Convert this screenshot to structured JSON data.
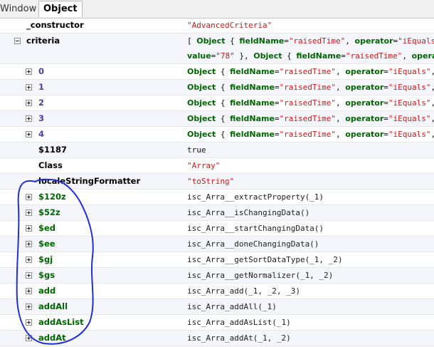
{
  "tabs": {
    "window": "Window",
    "object": "Object"
  },
  "rows": [
    {
      "name": "_constructor",
      "value": "\"AdvancedCriteria\""
    },
    {
      "name": "criteria",
      "line1": [
        {
          "t": "[ ",
          "c": "p"
        },
        {
          "t": "Object",
          "c": "k"
        },
        {
          "t": " { ",
          "c": "p"
        },
        {
          "t": "fieldName",
          "c": "k"
        },
        {
          "t": "=",
          "c": "p"
        },
        {
          "t": "\"raisedTime\"",
          "c": "s"
        },
        {
          "t": ", ",
          "c": "p"
        },
        {
          "t": "operator",
          "c": "k"
        },
        {
          "t": "=",
          "c": "p"
        },
        {
          "t": "\"iEquals\"",
          "c": "s"
        },
        {
          "t": ",",
          "c": "p"
        }
      ],
      "line2": [
        {
          "t": "value",
          "c": "k"
        },
        {
          "t": "=",
          "c": "p"
        },
        {
          "t": "\"78\"",
          "c": "s"
        },
        {
          "t": " }, ",
          "c": "p"
        },
        {
          "t": "Object",
          "c": "k"
        },
        {
          "t": " { ",
          "c": "p"
        },
        {
          "t": "fieldName",
          "c": "k"
        },
        {
          "t": "=",
          "c": "p"
        },
        {
          "t": "\"raisedTime\"",
          "c": "s"
        },
        {
          "t": ", ",
          "c": "p"
        },
        {
          "t": "operato",
          "c": "k"
        }
      ]
    },
    {
      "name": "0",
      "value": [
        {
          "t": "Object",
          "c": "k"
        },
        {
          "t": " { ",
          "c": "p"
        },
        {
          "t": "fieldName",
          "c": "k"
        },
        {
          "t": "=",
          "c": "p"
        },
        {
          "t": "\"raisedTime\"",
          "c": "s"
        },
        {
          "t": ", ",
          "c": "p"
        },
        {
          "t": "operator",
          "c": "k"
        },
        {
          "t": "=",
          "c": "p"
        },
        {
          "t": "\"iEquals\"",
          "c": "s"
        },
        {
          "t": ",",
          "c": "p"
        }
      ]
    },
    {
      "name": "1",
      "value": [
        {
          "t": "Object",
          "c": "k"
        },
        {
          "t": " { ",
          "c": "p"
        },
        {
          "t": "fieldName",
          "c": "k"
        },
        {
          "t": "=",
          "c": "p"
        },
        {
          "t": "\"raisedTime\"",
          "c": "s"
        },
        {
          "t": ", ",
          "c": "p"
        },
        {
          "t": "operator",
          "c": "k"
        },
        {
          "t": "=",
          "c": "p"
        },
        {
          "t": "\"iEquals\"",
          "c": "s"
        },
        {
          "t": ",",
          "c": "p"
        }
      ]
    },
    {
      "name": "2",
      "value": [
        {
          "t": "Object",
          "c": "k"
        },
        {
          "t": " { ",
          "c": "p"
        },
        {
          "t": "fieldName",
          "c": "k"
        },
        {
          "t": "=",
          "c": "p"
        },
        {
          "t": "\"raisedTime\"",
          "c": "s"
        },
        {
          "t": ", ",
          "c": "p"
        },
        {
          "t": "operator",
          "c": "k"
        },
        {
          "t": "=",
          "c": "p"
        },
        {
          "t": "\"iEquals\"",
          "c": "s"
        },
        {
          "t": ",",
          "c": "p"
        }
      ]
    },
    {
      "name": "3",
      "value": [
        {
          "t": "Object",
          "c": "k"
        },
        {
          "t": " { ",
          "c": "p"
        },
        {
          "t": "fieldName",
          "c": "k"
        },
        {
          "t": "=",
          "c": "p"
        },
        {
          "t": "\"raisedTime\"",
          "c": "s"
        },
        {
          "t": ", ",
          "c": "p"
        },
        {
          "t": "operator",
          "c": "k"
        },
        {
          "t": "=",
          "c": "p"
        },
        {
          "t": "\"iEquals\"",
          "c": "s"
        },
        {
          "t": ",",
          "c": "p"
        }
      ]
    },
    {
      "name": "4",
      "value": [
        {
          "t": "Object",
          "c": "k"
        },
        {
          "t": " { ",
          "c": "p"
        },
        {
          "t": "fieldName",
          "c": "k"
        },
        {
          "t": "=",
          "c": "p"
        },
        {
          "t": "\"raisedTime\"",
          "c": "s"
        },
        {
          "t": ", ",
          "c": "p"
        },
        {
          "t": "operator",
          "c": "k"
        },
        {
          "t": "=",
          "c": "p"
        },
        {
          "t": "\"iEquals\"",
          "c": "s"
        },
        {
          "t": ",",
          "c": "p"
        }
      ]
    },
    {
      "name": "$1187",
      "value": "true"
    },
    {
      "name": "Class",
      "value": "\"Array\""
    },
    {
      "name": "localeStringFormatter",
      "value": "\"toString\""
    },
    {
      "name": "$120z",
      "value": "isc_Arra__extractProperty(_1)"
    },
    {
      "name": "$52z",
      "value": "isc_Arra__isChangingData()"
    },
    {
      "name": "$ed",
      "value": "isc_Arra__startChangingData()"
    },
    {
      "name": "$ee",
      "value": "isc_Arra__doneChangingData()"
    },
    {
      "name": "$gj",
      "value": "isc_Arra__getSortDataType(_1, _2)"
    },
    {
      "name": "$gs",
      "value": "isc_Arra__getNormalizer(_1, _2)"
    },
    {
      "name": "add",
      "value": "isc_Arra_add(_1, _2, _3)"
    },
    {
      "name": "addAll",
      "value": "isc_Arra_addAll(_1)"
    },
    {
      "name": "addAsList",
      "value": "isc_Arra_addAsList(_1)"
    },
    {
      "name": "addAt",
      "value": "isc_Arra_addAt(_1, _2)"
    }
  ],
  "colors": {
    "string": "#cc1a1a",
    "key": "#006400",
    "index": "#4b3fa6",
    "annotation": "#1f2fd6"
  }
}
